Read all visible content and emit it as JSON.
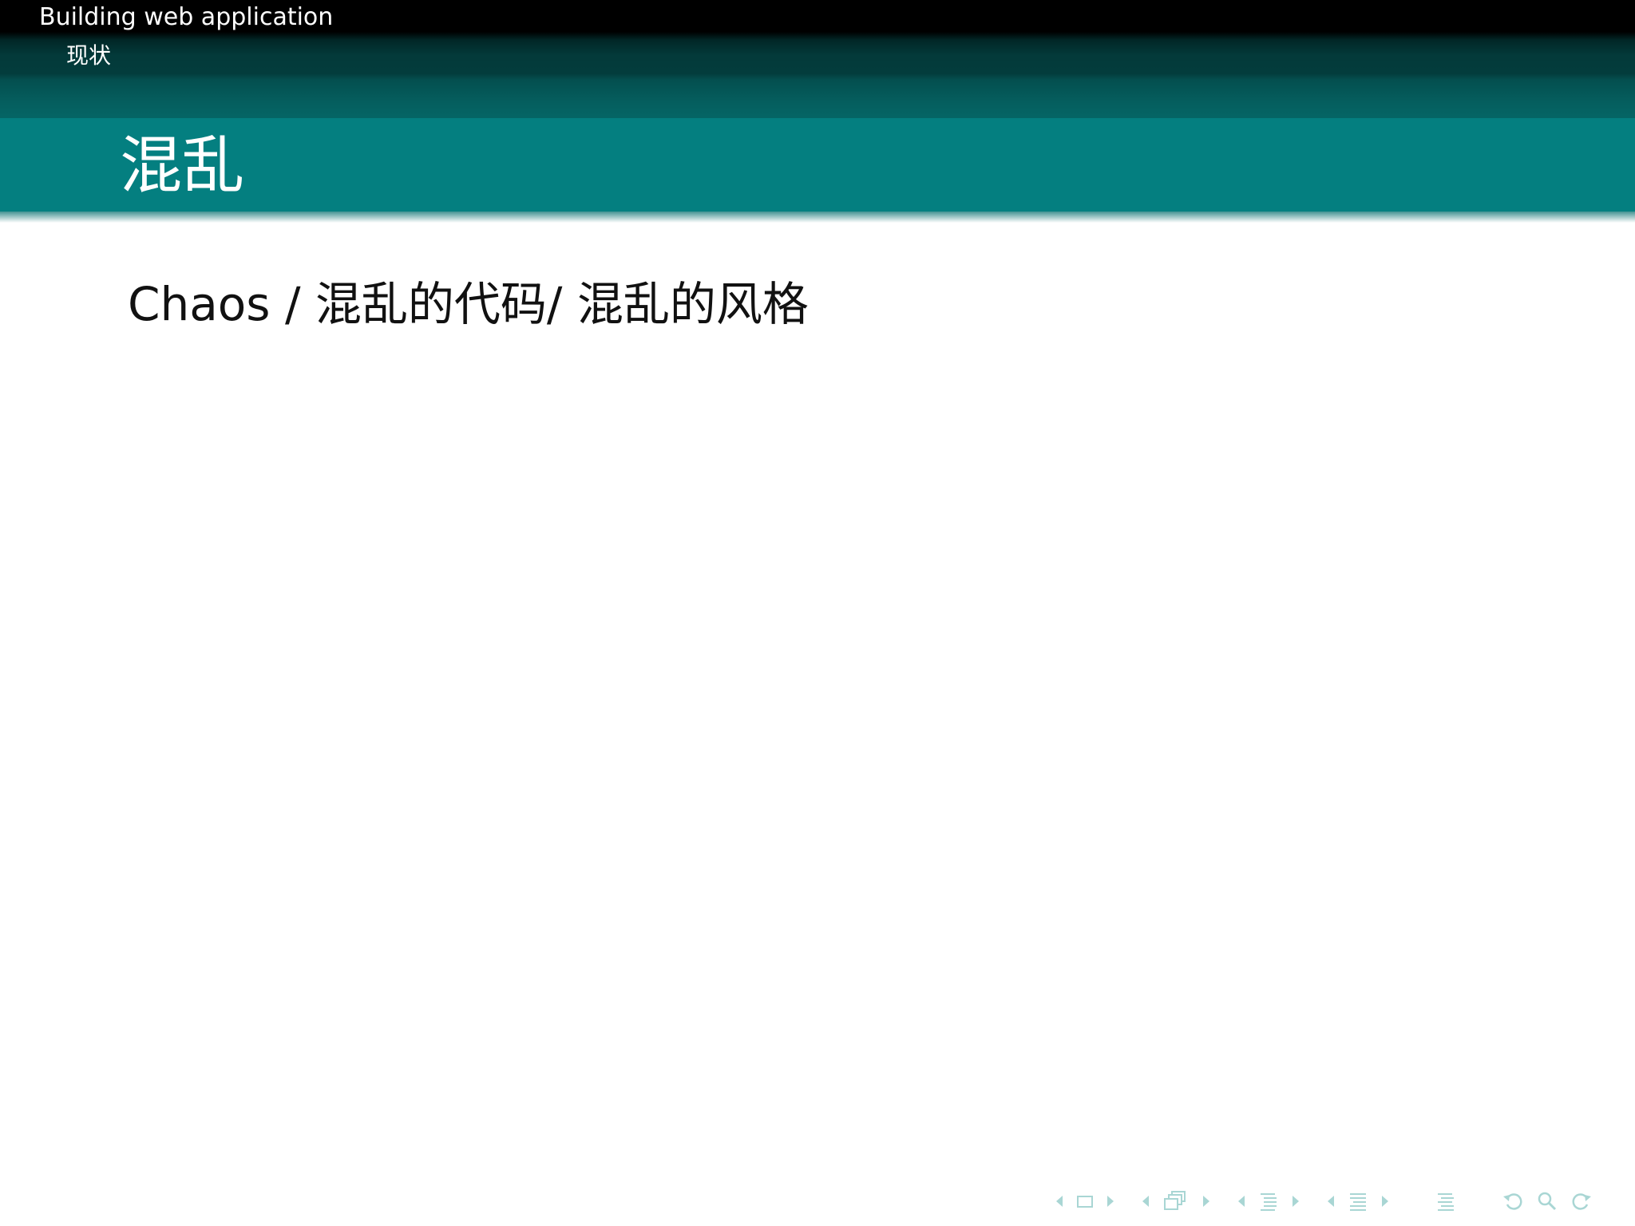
{
  "header": {
    "presentation_title": "Building web application",
    "section_title": "现状"
  },
  "frame": {
    "title": "混乱",
    "body_text": "Chaos / 混乱的代码/ 混乱的风格"
  },
  "navigation": {
    "icons": [
      "arrow-left-icon",
      "slide-icon",
      "arrow-right-icon",
      "arrow-left-icon",
      "frame-icon",
      "arrow-right-icon",
      "arrow-left-icon",
      "subsection-icon",
      "arrow-right-icon",
      "arrow-left-icon",
      "section-icon",
      "arrow-right-icon",
      "document-icon",
      "back-icon",
      "search-icon",
      "forward-icon"
    ],
    "icon_color": "#a9d6d4"
  },
  "colors": {
    "headline_dark": "#000000",
    "frametitle_bg": "#047f80",
    "text_light": "#ffffff",
    "body_text": "#111111"
  }
}
